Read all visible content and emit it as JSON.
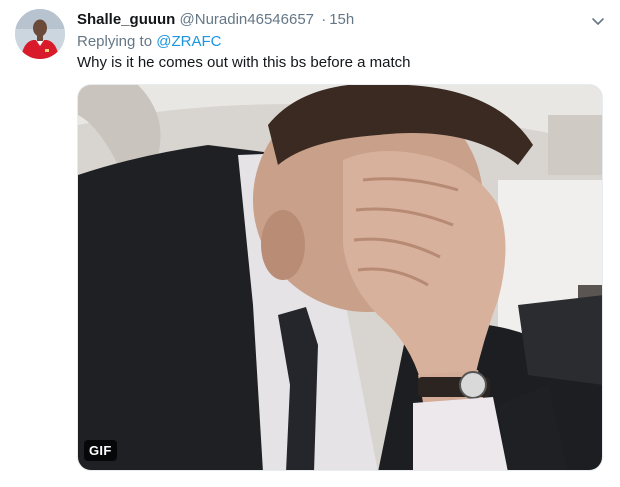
{
  "tweet": {
    "display_name": "Shalle_guuun",
    "handle": "@Nuradin46546657",
    "separator": "·",
    "time": "15h",
    "replying_prefix": "Replying to",
    "replying_to": "@ZRAFC",
    "text": "Why is it he comes out with this bs before a match",
    "media_badge": "GIF"
  },
  "icons": {
    "menu": "chevron-down-icon",
    "avatar": "avatar"
  },
  "colors": {
    "link": "#1b95e0",
    "secondary_text": "#657786",
    "primary_text": "#14171a",
    "jersey_red": "#d81a2a"
  }
}
